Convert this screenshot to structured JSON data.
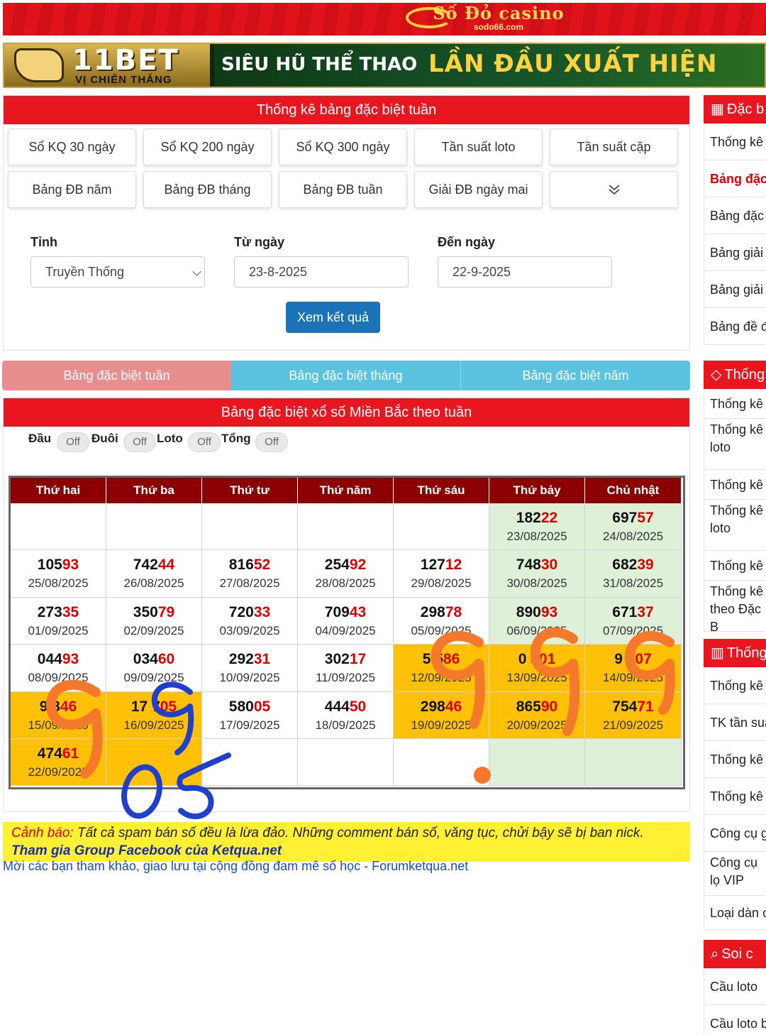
{
  "banner_top": {
    "logo_text": "Số Đỏ casino",
    "logo_url": "sodo66.com"
  },
  "banner_ad": {
    "brand": "11BET",
    "tagline": "VỊ CHIẾN THẮNG",
    "slogan_a": "SIÊU HŨ THỂ THAO",
    "slogan_b": "LẦN ĐẦU XUẤT HIỆN"
  },
  "stats_card": {
    "title": "Thống kê bảng đặc biệt tuần",
    "buttons": [
      "Sổ KQ 30 ngày",
      "Sổ KQ 200 ngày",
      "Sổ KQ 300 ngày",
      "Tần suất loto",
      "Tần suất cặp",
      "Bảng ĐB năm",
      "Bảng ĐB tháng",
      "Bảng ĐB tuần",
      "Giải ĐB ngày mai",
      ""
    ],
    "filters": {
      "province_label": "Tỉnh",
      "province_value": "Truyền Thống",
      "from_label": "Từ ngày",
      "from_value": "23-8-2025",
      "to_label": "Đến ngày",
      "to_value": "22-9-2025"
    },
    "submit_label": "Xem kết quả"
  },
  "tabs": [
    "Bảng đặc biệt tuần",
    "Bảng đặc biệt tháng",
    "Bảng đặc biệt năm"
  ],
  "result_card": {
    "title": "Bảng đặc biệt xổ số Miền Bắc theo tuần",
    "toggles": [
      {
        "label": "Đầu",
        "state": "Off"
      },
      {
        "label": "Đuôi",
        "state": "Off"
      },
      {
        "label": "Loto",
        "state": "Off"
      },
      {
        "label": "Tổng",
        "state": "Off"
      }
    ],
    "headers": [
      "Thứ hai",
      "Thứ ba",
      "Thứ tư",
      "Thứ năm",
      "Thứ sáu",
      "Thứ bảy",
      "Chủ nhật"
    ],
    "rows": [
      [
        null,
        null,
        null,
        null,
        null,
        {
          "head": "182",
          "tail": "22",
          "date": "23/08/2025"
        },
        {
          "head": "697",
          "tail": "57",
          "date": "24/08/2025"
        }
      ],
      [
        {
          "head": "105",
          "tail": "93",
          "date": "25/08/2025"
        },
        {
          "head": "742",
          "tail": "44",
          "date": "26/08/2025"
        },
        {
          "head": "816",
          "tail": "52",
          "date": "27/08/2025"
        },
        {
          "head": "254",
          "tail": "92",
          "date": "28/08/2025"
        },
        {
          "head": "127",
          "tail": "12",
          "date": "29/08/2025"
        },
        {
          "head": "748",
          "tail": "30",
          "date": "30/08/2025"
        },
        {
          "head": "682",
          "tail": "39",
          "date": "31/08/2025"
        }
      ],
      [
        {
          "head": "273",
          "tail": "35",
          "date": "01/09/2025"
        },
        {
          "head": "350",
          "tail": "79",
          "date": "02/09/2025"
        },
        {
          "head": "720",
          "tail": "33",
          "date": "03/09/2025"
        },
        {
          "head": "709",
          "tail": "43",
          "date": "04/09/2025"
        },
        {
          "head": "298",
          "tail": "78",
          "date": "05/09/2025"
        },
        {
          "head": "890",
          "tail": "93",
          "date": "06/09/2025"
        },
        {
          "head": "671",
          "tail": "37",
          "date": "07/09/2025"
        }
      ],
      [
        {
          "head": "044",
          "tail": "93",
          "date": "08/09/2025"
        },
        {
          "head": "034",
          "tail": "60",
          "date": "09/09/2025"
        },
        {
          "head": "292",
          "tail": "31",
          "date": "10/09/2025"
        },
        {
          "head": "302",
          "tail": "17",
          "date": "11/09/2025"
        },
        {
          "head": "5 5",
          "tail": "86",
          "date": "12/09/2025"
        },
        {
          "head": "0 4",
          "tail": "01",
          "date": "13/09/2025"
        },
        {
          "head": "9 9",
          "tail": "07",
          "date": "14/09/2025"
        }
      ],
      [
        {
          "head": "9 3",
          "tail": "46",
          "date": "15/09/2025"
        },
        {
          "head": "17 7",
          "tail": "05",
          "date": "16/09/2025"
        },
        {
          "head": "580",
          "tail": "05",
          "date": "17/09/2025"
        },
        {
          "head": "444",
          "tail": "50",
          "date": "18/09/2025"
        },
        {
          "head": "298",
          "tail": "46",
          "date": "19/09/2025"
        },
        {
          "head": "865",
          "tail": "90",
          "date": "20/09/2025"
        },
        {
          "head": "754",
          "tail": "71",
          "date": "21/09/2025"
        }
      ],
      [
        {
          "head": "474",
          "tail": "61",
          "date": "22/09/2025"
        },
        null,
        null,
        null,
        null,
        null,
        null
      ]
    ]
  },
  "warning": {
    "prefix": "Cảnh báo:",
    "text": " Tất cả spam bán số đều là lừa đảo. Những comment bán số, văng tục, chửi bậy sẽ bị ban nick.",
    "group_link": "Tham gia Group Facebook của Ketqua.net"
  },
  "forum_link": "Mời các bạn tham khảo, giao lưu tại cộng đồng đam mê số học - Forumketqua.net",
  "sidebar": {
    "section1": {
      "title": "Đặc b",
      "items": [
        "Thống kê",
        "Bảng đặc",
        "Bảng đặc",
        "Bảng giải",
        "Bảng giải",
        "Bảng đề đ"
      ]
    },
    "section2": {
      "title": "Thống",
      "items": [
        "Thống kê",
        "Thống kê loto",
        "Thống kê",
        "Thống kê loto",
        "Thống kê",
        "Thống kê theo Đặc B"
      ]
    },
    "section3": {
      "title": "Thống",
      "items": [
        "Thống kê",
        "TK tần suấ",
        "Thống kê",
        "Thống kê",
        "Công cụ g",
        "Công cụ lọ VIP",
        "Loại dàn c"
      ]
    },
    "section4": {
      "title": "Soi c",
      "items": [
        "Cầu loto",
        "Cầu loto b"
      ]
    }
  },
  "colors": {
    "red_header": "#e8161e",
    "table_header": "#8b0000",
    "highlight_yellow": "#ffc107",
    "weekend_green": "#dff0d8",
    "primary_blue": "#1c73b8",
    "tab_blue": "#5bc3df"
  }
}
